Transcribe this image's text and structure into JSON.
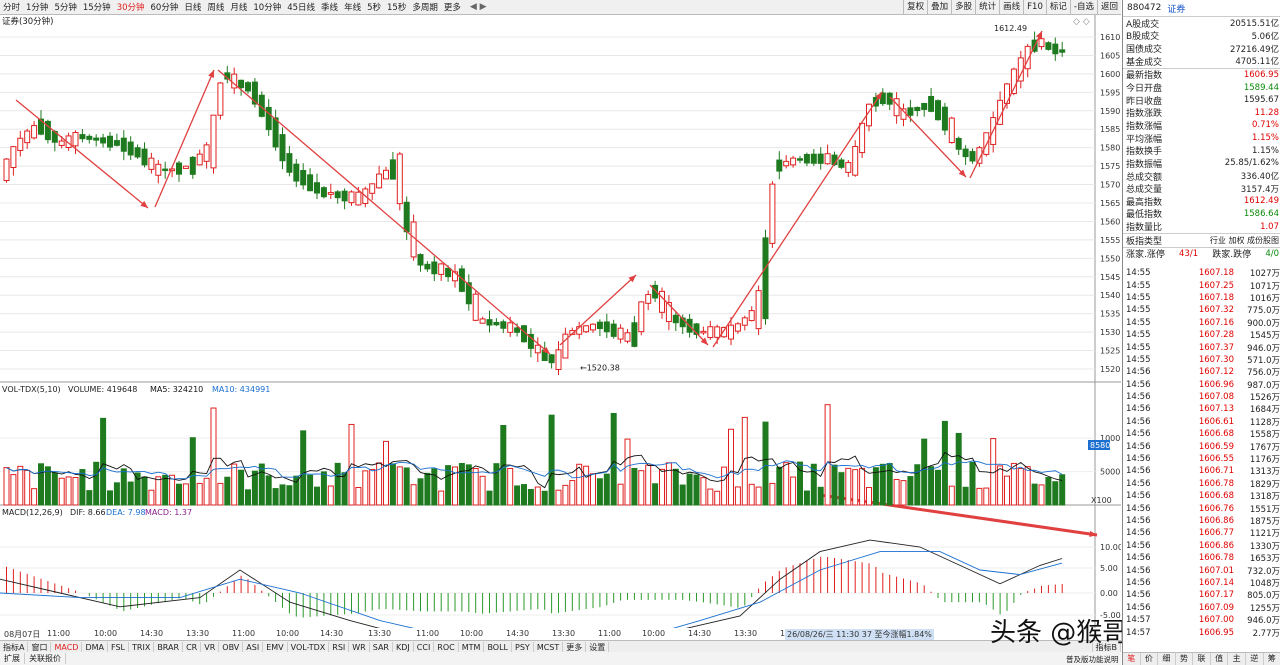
{
  "periods": [
    "分时",
    "1分钟",
    "5分钟",
    "15分钟",
    "30分钟",
    "60分钟",
    "日线",
    "周线",
    "月线",
    "10分钟",
    "45日线",
    "季线",
    "年线",
    "5秒",
    "15秒",
    "多周期",
    "更多"
  ],
  "active_period": "30分钟",
  "toolbar_buttons": [
    "复权",
    "叠加",
    "多股",
    "统计",
    "画线",
    "F10",
    "标记",
    "-自选",
    "返回"
  ],
  "chart_title": "证券(30分钟)",
  "price_axis": [
    "1610",
    "1605",
    "1600",
    "1595",
    "1590",
    "1585",
    "1580",
    "1575",
    "1570",
    "1565",
    "1560",
    "1555",
    "1550",
    "1545",
    "1540",
    "1535",
    "1530",
    "1525",
    "1520"
  ],
  "high_label": "1612.49",
  "low_label": "1520.38",
  "vol_header": {
    "name": "VOL-TDX(5,10)",
    "volume": "VOLUME: 419648",
    "ma5": "MA5: 324210",
    "ma10": "MA10: 434991"
  },
  "vol_axis": [
    "10000",
    "5000"
  ],
  "vol_unit": "X100",
  "vol_marker": "8580",
  "macd_header": {
    "name": "MACD(12,26,9)",
    "dif": "DIF: 8.66",
    "dea": "DEA: 7.98",
    "macd": "MACD: 1.37"
  },
  "macd_axis": [
    "10.00",
    "5.00",
    "0.00",
    "-5.00"
  ],
  "time_labels": [
    "08月07日",
    "11:00",
    "10:00",
    "14:30",
    "13:30",
    "11:00",
    "10:00",
    "14:30",
    "13:30",
    "11:00",
    "10:00",
    "14:30",
    "13:30",
    "11:00",
    "10:00",
    "14:30",
    "13:30",
    "11:00",
    "10:00",
    "14:30"
  ],
  "time_tip": "26/08/26/三 11:30 37 至今涨幅1.84%",
  "indicators": [
    "指标A",
    "窗口",
    "MACD",
    "DMA",
    "FSL",
    "TRIX",
    "BRAR",
    "CR",
    "VR",
    "OBV",
    "ASI",
    "EMV",
    "VOL-TDX",
    "RSI",
    "WR",
    "SAR",
    "KDJ",
    "CCI",
    "ROC",
    "MTM",
    "BOLL",
    "PSY",
    "MCST",
    "更多",
    "设置"
  ],
  "active_indicator": "MACD",
  "ext_buttons": [
    "扩展",
    "关联报价"
  ],
  "right_indicator_btn": "指标B",
  "panel": {
    "code": "880472",
    "name": "证券",
    "stats": [
      {
        "k": "A股成交",
        "v": "20515.51亿",
        "c": ""
      },
      {
        "k": "B股成交",
        "v": "5.06亿",
        "c": ""
      },
      {
        "k": "国债成交",
        "v": "27216.49亿",
        "c": ""
      },
      {
        "k": "基金成交",
        "v": "4705.11亿",
        "c": ""
      },
      {
        "k": "最新指数",
        "v": "1606.95",
        "c": "red"
      },
      {
        "k": "今日开盘",
        "v": "1589.44",
        "c": "green"
      },
      {
        "k": "昨日收盘",
        "v": "1595.67",
        "c": ""
      },
      {
        "k": "指数涨跌",
        "v": "11.28",
        "c": "red"
      },
      {
        "k": "指数涨幅",
        "v": "0.71%",
        "c": "red"
      },
      {
        "k": "平均涨幅",
        "v": "1.15%",
        "c": "red"
      },
      {
        "k": "指数换手",
        "v": "1.15%",
        "c": ""
      },
      {
        "k": "指数振幅",
        "v": "25.85/1.62%",
        "c": ""
      },
      {
        "k": "总成交额",
        "v": "336.40亿",
        "c": ""
      },
      {
        "k": "总成交量",
        "v": "3157.4万",
        "c": ""
      },
      {
        "k": "最高指数",
        "v": "1612.49",
        "c": "red"
      },
      {
        "k": "最低指数",
        "v": "1586.64",
        "c": "green"
      },
      {
        "k": "指数量比",
        "v": "1.07",
        "c": "red"
      }
    ],
    "type_row": {
      "k": "板指类型",
      "v": "行业 加权 成份股图"
    },
    "limit_row": {
      "a": "涨家.涨停",
      "av": "43/1",
      "b": "跌家.跌停",
      "bv": "4/0"
    },
    "ticks": [
      [
        "14:55",
        "1607.18",
        "1027万"
      ],
      [
        "14:55",
        "1607.25",
        "1071万"
      ],
      [
        "14:55",
        "1607.18",
        "1016万"
      ],
      [
        "14:55",
        "1607.32",
        "775.0万"
      ],
      [
        "14:55",
        "1607.16",
        "900.0万"
      ],
      [
        "14:55",
        "1607.28",
        "1545万"
      ],
      [
        "14:55",
        "1607.37",
        "946.0万"
      ],
      [
        "14:55",
        "1607.30",
        "571.0万"
      ],
      [
        "14:56",
        "1607.12",
        "756.0万"
      ],
      [
        "14:56",
        "1606.96",
        "987.0万"
      ],
      [
        "14:56",
        "1607.08",
        "1526万"
      ],
      [
        "14:56",
        "1607.13",
        "1684万"
      ],
      [
        "14:56",
        "1606.61",
        "1128万"
      ],
      [
        "14:56",
        "1606.68",
        "1558万"
      ],
      [
        "14:56",
        "1606.59",
        "1767万"
      ],
      [
        "14:56",
        "1606.55",
        "1176万"
      ],
      [
        "14:56",
        "1606.71",
        "1313万"
      ],
      [
        "14:56",
        "1606.78",
        "1829万"
      ],
      [
        "14:56",
        "1606.68",
        "1318万"
      ],
      [
        "14:56",
        "1606.76",
        "1551万"
      ],
      [
        "14:56",
        "1606.86",
        "1875万"
      ],
      [
        "14:56",
        "1606.77",
        "1121万"
      ],
      [
        "14:56",
        "1606.86",
        "1330万"
      ],
      [
        "14:56",
        "1606.78",
        "1653万"
      ],
      [
        "14:56",
        "1607.01",
        "732.0万"
      ],
      [
        "14:56",
        "1607.14",
        "1048万"
      ],
      [
        "14:56",
        "1607.17",
        "805.0万"
      ],
      [
        "14:56",
        "1607.09",
        "1255万"
      ],
      [
        "14:57",
        "1607.00",
        "946.0万"
      ],
      [
        "14:57",
        "1606.95",
        "2.77万"
      ]
    ],
    "bottom_tabs": [
      "笔",
      "价",
      "细",
      "势",
      "联",
      "值",
      "主",
      "逆",
      "筹"
    ],
    "active_tab": "笔"
  },
  "reclinks": "普及版功能说明",
  "watermark": "头条 @猴哥聊缠论",
  "colors": {
    "up": "#e02020",
    "down": "#1f7a1f",
    "ma5": "#111111",
    "ma10": "#1a6fd0",
    "arrow": "#e04040"
  }
}
